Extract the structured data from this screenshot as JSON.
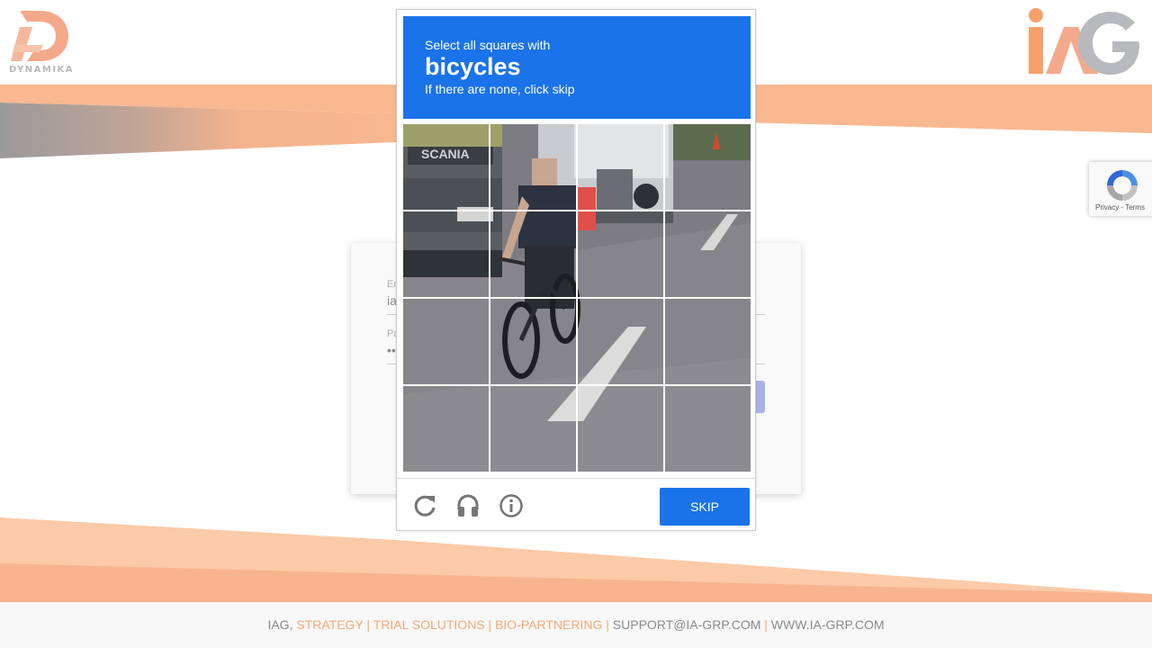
{
  "brand": {
    "left_logo_text": "DYNAMIKA",
    "right_logo_text": "iAG",
    "accent_color": "#f7a874",
    "captcha_blue": "#1a73e8"
  },
  "login": {
    "email_label": "Em",
    "email_value": "ia",
    "password_label": "Pa",
    "password_value": "••"
  },
  "captcha": {
    "instruction_line1": "Select all squares with",
    "target": "bicycles",
    "instruction_line3": "If there are none, click skip",
    "grid_size": "4x4",
    "skip_label": "SKIP",
    "icons": [
      "reload-icon",
      "audio-icon",
      "info-icon"
    ]
  },
  "recaptcha_badge": {
    "links": "Privacy - Terms"
  },
  "footer": {
    "iag": "IAG,",
    "strategy": "STRATEGY",
    "sep1": "|",
    "trial": "TRIAL SOLUTIONS",
    "sep2": "|",
    "bio": "BIO-PARTNERING",
    "sep3": "|",
    "email": "SUPPORT@IA-GRP.COM",
    "sep4": "|",
    "web": "WWW.IA-GRP.COM"
  }
}
